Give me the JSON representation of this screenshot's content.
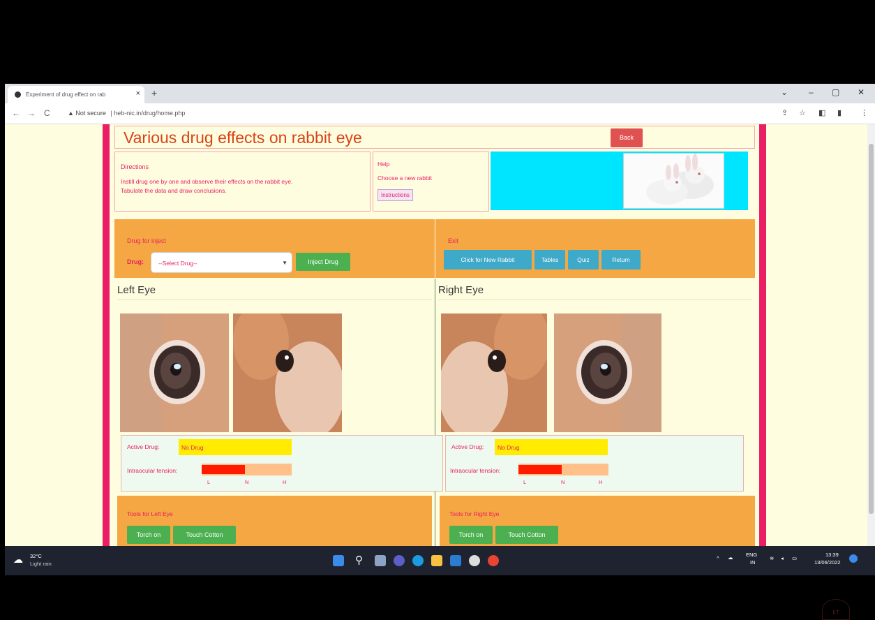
{
  "browser": {
    "tab_title": "Experiment of drug effect on rab",
    "new_tab": "+",
    "url_warning": "▲ Not secure",
    "url": "| heb-nic.in/drug/home.php"
  },
  "header": {
    "title": "Various drug effects on rabbit eye",
    "back_label": "Back"
  },
  "directions": {
    "heading": "Directions",
    "line1": "Instill drug one by one and observe their effects on the rabbit eye.",
    "line2": "Tabulate the data and draw conclusions."
  },
  "help": {
    "heading": "Help",
    "text": "Choose a new rabbit",
    "instructions_label": "Instructions"
  },
  "inject": {
    "heading": "Drug for inject",
    "drug_label": "Drug:",
    "select_value": "--Select Drug--",
    "inject_label": "Inject Drug"
  },
  "exit": {
    "heading": "Exit",
    "buttons": [
      "Click for New Rabbit",
      "Tables",
      "Quiz",
      "Return"
    ]
  },
  "left_eye": {
    "heading": "Left Eye",
    "active_drug_label": "Active Drug:",
    "active_drug_value": "No Drug",
    "tension_label": "Intraocular tension:",
    "tension_level": 0.48,
    "scale": [
      "L",
      "N",
      "H"
    ],
    "tools_heading": "Tools for Left Eye",
    "torch_label": "Torch on",
    "cotton_label": "Touch Cotton"
  },
  "right_eye": {
    "heading": "Right Eye",
    "active_drug_label": "Active Drug:",
    "active_drug_value": "No Drug",
    "tension_label": "Intraocular tension:",
    "tension_level": 0.48,
    "scale": [
      "L",
      "N",
      "H"
    ],
    "tools_heading": "Tools for Right Eye",
    "torch_label": "Torch on",
    "cotton_label": "Touch Cotton"
  },
  "taskbar": {
    "weather_temp": "32°C",
    "weather_text": "Light rain",
    "lang": "ENG",
    "region": "IN",
    "time": "13:39",
    "date": "13/06/2022"
  },
  "watermark": "IIT",
  "colors": {
    "page_bg": "#fffde0",
    "accent_pink": "#e91e63",
    "orange_panel": "#f4a742",
    "green_button": "#4caf50",
    "blue_button": "#3fa9c9",
    "back_button": "#e05252",
    "tension_fill": "#ff1a00"
  }
}
